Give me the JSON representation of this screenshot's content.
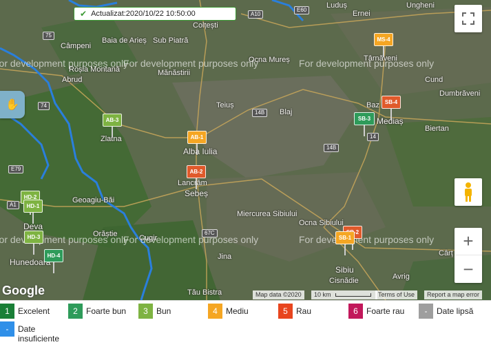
{
  "status": {
    "text": "Actualizat:2020/10/22 10:50:00"
  },
  "map": {
    "watermark": "For development purposes only",
    "places": [
      {
        "name": "Ludus",
        "text": "Luduș"
      },
      {
        "name": "Ernei",
        "text": "Ernei"
      },
      {
        "name": "Ungheni",
        "text": "Ungheni"
      },
      {
        "name": "Coltesti",
        "text": "Colțești"
      },
      {
        "name": "Campeni",
        "text": "Câmpeni"
      },
      {
        "name": "BaiaDeAries",
        "text": "Baia de Arieș"
      },
      {
        "name": "SubPiatra",
        "text": "Sub Piatră"
      },
      {
        "name": "OcnaMures",
        "text": "Ocna Mureș"
      },
      {
        "name": "Tarnaveni",
        "text": "Târnăveni"
      },
      {
        "name": "RosiaMontana",
        "text": "Roșia Montană"
      },
      {
        "name": "Manastirii",
        "text": "Mănăstirii"
      },
      {
        "name": "Abrud",
        "text": "Abrud"
      },
      {
        "name": "Cund",
        "text": "Cund"
      },
      {
        "name": "Dumbraveni",
        "text": "Dumbrăveni"
      },
      {
        "name": "Teius",
        "text": "Teiuș"
      },
      {
        "name": "Blaj",
        "text": "Blaj"
      },
      {
        "name": "Baz",
        "text": "Baz"
      },
      {
        "name": "Medias",
        "text": "Mediaș"
      },
      {
        "name": "Zlatna",
        "text": "Zlatna"
      },
      {
        "name": "AlbaIulia",
        "text": "Alba Iulia"
      },
      {
        "name": "Biertan",
        "text": "Biertan"
      },
      {
        "name": "Lancram",
        "text": "Lancrăm"
      },
      {
        "name": "Sebes",
        "text": "Sebeș"
      },
      {
        "name": "GeoagiuBai",
        "text": "Geoagiu-Băi"
      },
      {
        "name": "Deva",
        "text": "Deva"
      },
      {
        "name": "Orastie",
        "text": "Orăștie"
      },
      {
        "name": "Cugir",
        "text": "Cugir"
      },
      {
        "name": "MiercureaSibiului",
        "text": "Miercurea Sibiului"
      },
      {
        "name": "OcnaSibiului",
        "text": "Ocna Sibiului"
      },
      {
        "name": "Hunedoara",
        "text": "Hunedoara"
      },
      {
        "name": "Jina",
        "text": "Jina"
      },
      {
        "name": "Sibiu",
        "text": "Sibiu"
      },
      {
        "name": "Cartisoara",
        "text": "Cârț"
      },
      {
        "name": "Cisnadie",
        "text": "Cisnădie"
      },
      {
        "name": "Avrig",
        "text": "Avrig"
      },
      {
        "name": "TauBistra",
        "text": "Tău Bistra"
      }
    ],
    "roads": [
      "E60",
      "A10",
      "75",
      "74",
      "14B",
      "14",
      "E79",
      "A1",
      "67C",
      "14B"
    ],
    "attribution": {
      "map_data": "Map data ©2020",
      "scale": "10 km",
      "terms": "Terms of Use",
      "report": "Report a map error"
    },
    "google_logo": "Google"
  },
  "markers": [
    {
      "code": "MS-4",
      "level": 4,
      "color": "#f5a623"
    },
    {
      "code": "SB-4",
      "level": 5,
      "color": "#e05a2b"
    },
    {
      "code": "SB-3",
      "level": 2,
      "color": "#2e9b5a"
    },
    {
      "code": "AB-3",
      "level": 3,
      "color": "#7eb342"
    },
    {
      "code": "AB-1",
      "level": 4,
      "color": "#f5a623"
    },
    {
      "code": "AB-2",
      "level": 5,
      "color": "#e05a2b"
    },
    {
      "code": "HD-2",
      "level": 3,
      "color": "#7eb342"
    },
    {
      "code": "HD-1",
      "level": 3,
      "color": "#7eb342"
    },
    {
      "code": "HD-3",
      "level": 3,
      "color": "#7eb342"
    },
    {
      "code": "HD-4",
      "level": 2,
      "color": "#2e9b5a"
    },
    {
      "code": "SB-2",
      "level": 5,
      "color": "#e05a2b"
    },
    {
      "code": "SB-1",
      "level": 4,
      "color": "#f5a623"
    }
  ],
  "legend": [
    {
      "num": "1",
      "label": "Excelent",
      "color": "#1a7f37"
    },
    {
      "num": "2",
      "label": "Foarte bun",
      "color": "#2e9b5a"
    },
    {
      "num": "3",
      "label": "Bun",
      "color": "#7eb342"
    },
    {
      "num": "4",
      "label": "Mediu",
      "color": "#f5a623"
    },
    {
      "num": "5",
      "label": "Rau",
      "color": "#e8451e"
    },
    {
      "num": "6",
      "label": "Foarte rau",
      "color": "#c2185b"
    },
    {
      "num": "-",
      "label": "Date lipsă",
      "color": "#9e9e9e"
    },
    {
      "num": "-",
      "label": "Date insuficiente",
      "color": "#2f8fe8"
    }
  ],
  "controls": {
    "fullscreen_icon": "fullscreen-icon",
    "pegman_icon": "pegman-icon",
    "zoom_in": "+",
    "zoom_out": "−",
    "hand_icon": "hand-icon"
  }
}
